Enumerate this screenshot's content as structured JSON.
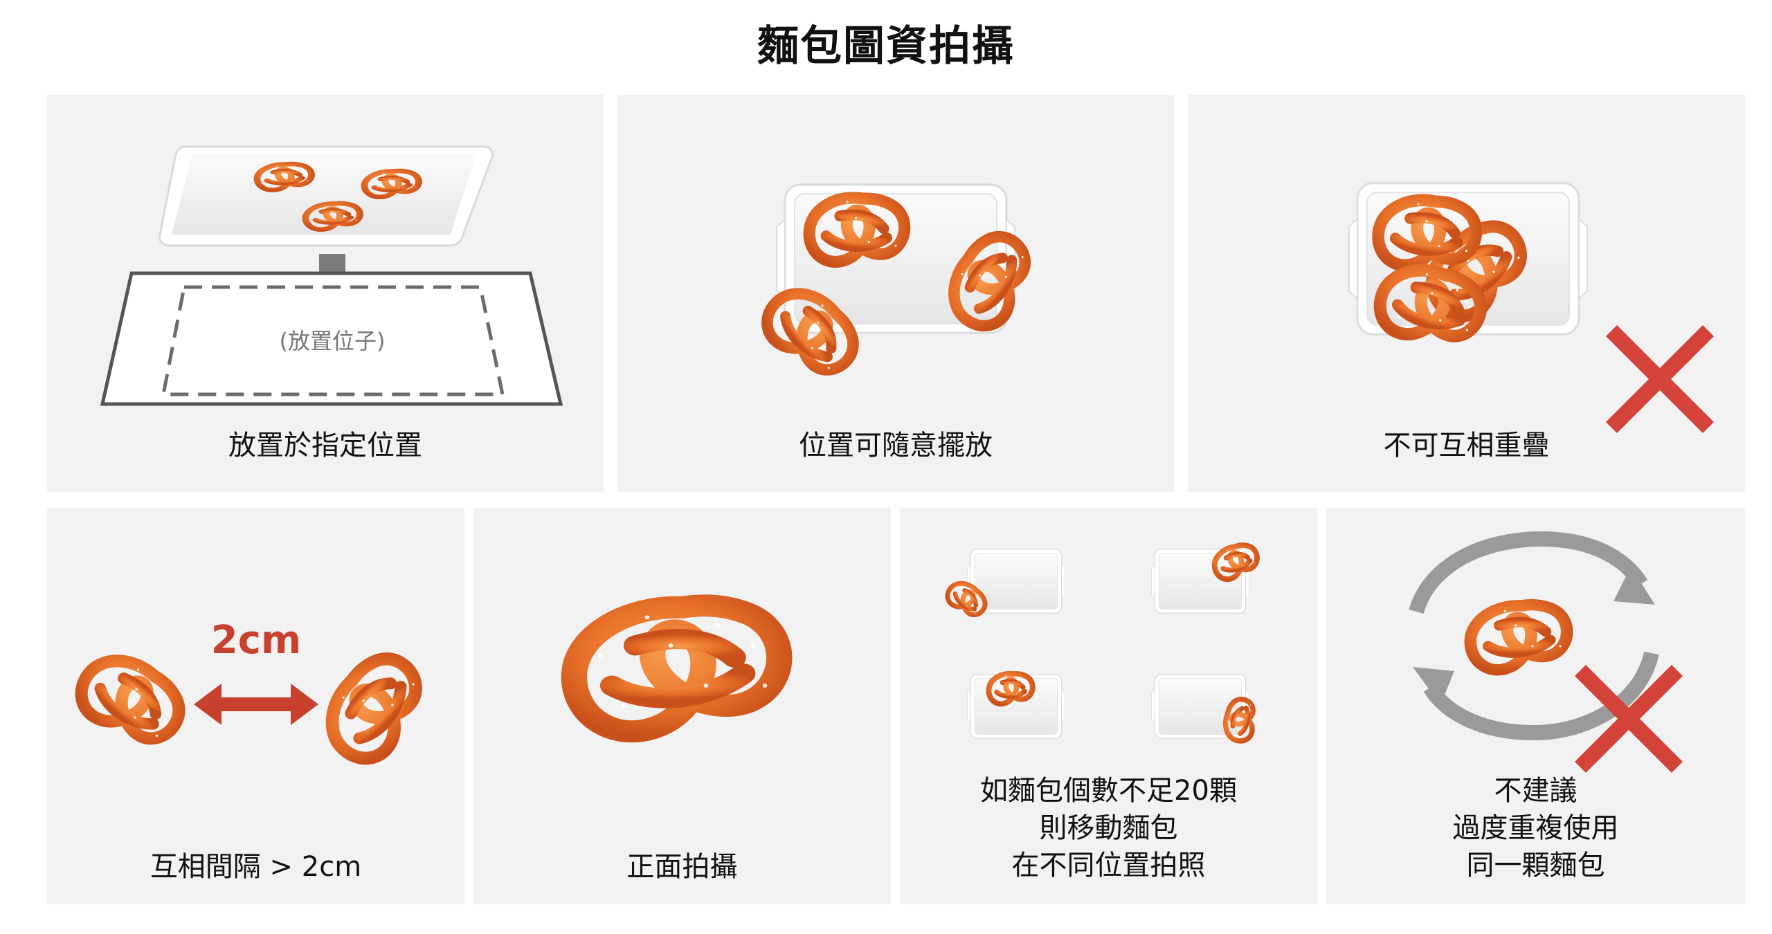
{
  "title": "麵包圖資拍攝",
  "panels": [
    {
      "caption": [
        "放置於指定位置"
      ],
      "placeholder_label": "(放置位子)"
    },
    {
      "caption": [
        "位置可隨意擺放"
      ]
    },
    {
      "caption": [
        "不可互相重疊"
      ]
    },
    {
      "caption": [
        "互相間隔 > 2cm"
      ],
      "distance_label": "2cm"
    },
    {
      "caption": [
        "正面拍攝"
      ]
    },
    {
      "caption": [
        "如麵包個數不足20顆",
        "則移動麵包",
        "在不同位置拍照"
      ]
    },
    {
      "caption": [
        "不建議",
        "過度重複使用",
        "同一顆麵包"
      ]
    }
  ],
  "colors": {
    "panel_bg": "#f2f2f2",
    "pretzel": "#e9722a",
    "pretzel_dark": "#c9501a",
    "cross": "#d3433a",
    "arrow_red": "#c8412f",
    "label_red": "#c8412f"
  },
  "icons": [
    "pretzel-icon",
    "tray-icon",
    "down-arrow-icon",
    "double-arrow-icon",
    "cross-icon",
    "cycle-arrows-icon"
  ]
}
